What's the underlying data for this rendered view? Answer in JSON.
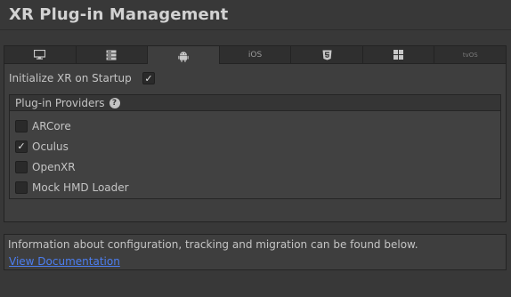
{
  "header": {
    "title": "XR Plug-in Management"
  },
  "platform_tabs": [
    {
      "label": "",
      "icon": "monitor-icon",
      "active": false
    },
    {
      "label": "",
      "icon": "server-icon",
      "active": false
    },
    {
      "label": "",
      "icon": "android-icon",
      "active": true
    },
    {
      "label": "iOS",
      "icon": "",
      "active": false
    },
    {
      "label": "",
      "icon": "html5-icon",
      "active": false
    },
    {
      "label": "",
      "icon": "windows-icon",
      "active": false
    },
    {
      "label": "tvOS",
      "icon": "",
      "active": false
    }
  ],
  "settings": {
    "init_label": "Initialize XR on Startup",
    "init_checked": true
  },
  "providers": {
    "header": "Plug-in Providers",
    "help_glyph": "?",
    "items": [
      {
        "label": "ARCore",
        "checked": false
      },
      {
        "label": "Oculus",
        "checked": true
      },
      {
        "label": "OpenXR",
        "checked": false
      },
      {
        "label": "Mock HMD Loader",
        "checked": false
      }
    ]
  },
  "info": {
    "text": "Information about configuration, tracking and migration can be found below.",
    "link_label": "View Documentation"
  },
  "colors": {
    "background": "#383838",
    "panel": "#3e3e3e",
    "link": "#4c7ef0"
  }
}
